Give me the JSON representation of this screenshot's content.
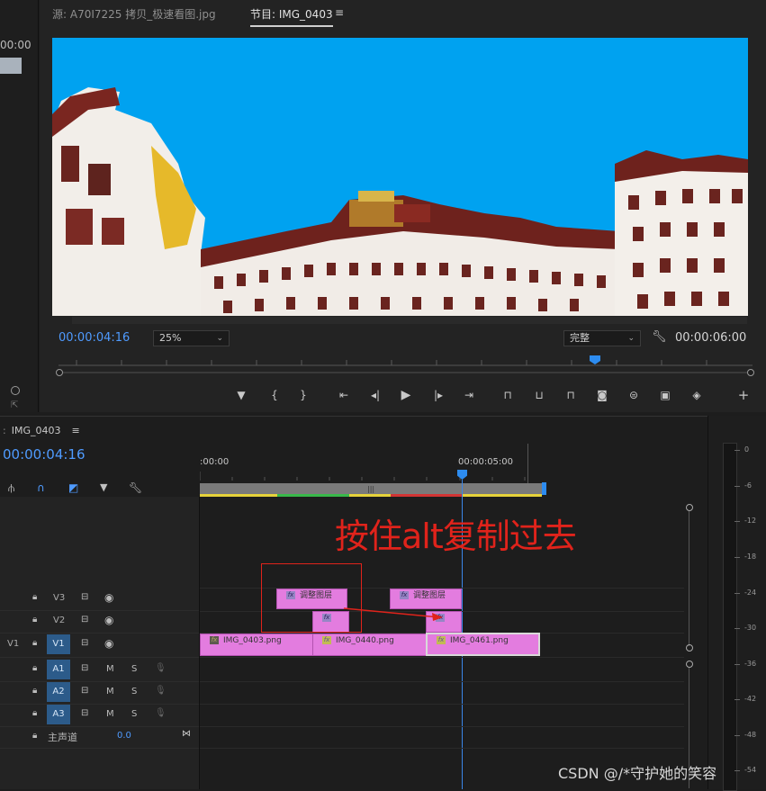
{
  "source_panel": {
    "tab_label": "源: A70I7225 拷贝_极速看图.jpg",
    "timecode_fragment": "00:00"
  },
  "program_panel": {
    "tab_label": "节目: IMG_0403",
    "menu_icon": "hamburger-icon",
    "current_time": "00:00:04:16",
    "zoom": "25%",
    "quality": "完整",
    "duration": "00:00:06:00",
    "playhead_progress_fraction": 0.69,
    "controls": [
      "marker-icon",
      "in-point-icon",
      "out-point-icon",
      "go-to-in-icon",
      "step-back-icon",
      "play-icon",
      "step-forward-icon",
      "go-to-out-icon",
      "insert-icon",
      "overwrite-icon",
      "lift-icon",
      "extract-icon",
      "export-frame-icon",
      "compare-icon",
      "button-editor-icon",
      "vr-icon",
      "add-icon"
    ]
  },
  "timeline": {
    "tab_label": "IMG_0403",
    "timecode": "00:00:04:16",
    "ruler": {
      "start": ":00:00",
      "mark": "00:00:05:00"
    },
    "annotation": "按住alt复制过去",
    "tracks": [
      {
        "id": "V3",
        "label": "V3",
        "type": "video"
      },
      {
        "id": "V2",
        "label": "V2",
        "type": "video"
      },
      {
        "id": "V1",
        "label": "V1",
        "source": "V1",
        "type": "video"
      },
      {
        "id": "A1",
        "label": "A1",
        "type": "audio",
        "m": "M",
        "s": "S"
      },
      {
        "id": "A2",
        "label": "A2",
        "type": "audio",
        "m": "M",
        "s": "S"
      },
      {
        "id": "A3",
        "label": "A3",
        "type": "audio",
        "m": "M",
        "s": "S"
      }
    ],
    "master": {
      "label": "主声道",
      "value": "0.0"
    },
    "clips": {
      "v3_a": "调整图层",
      "v3_b": "调整图层",
      "v1_a": "IMG_0403.png",
      "v1_b": "IMG_0440.png",
      "v1_c": "IMG_0461.png"
    }
  },
  "meter": {
    "scale": [
      "0",
      "-6",
      "-12",
      "-18",
      "-24",
      "-30",
      "-36",
      "-42",
      "-48",
      "-54"
    ]
  },
  "watermark": "CSDN @/*守护她的笑容",
  "colors": {
    "accent_blue": "#4f9bff",
    "clip_pink": "#e37cdf",
    "annotation_red": "#e0231b",
    "sky": "#00a2f0"
  }
}
